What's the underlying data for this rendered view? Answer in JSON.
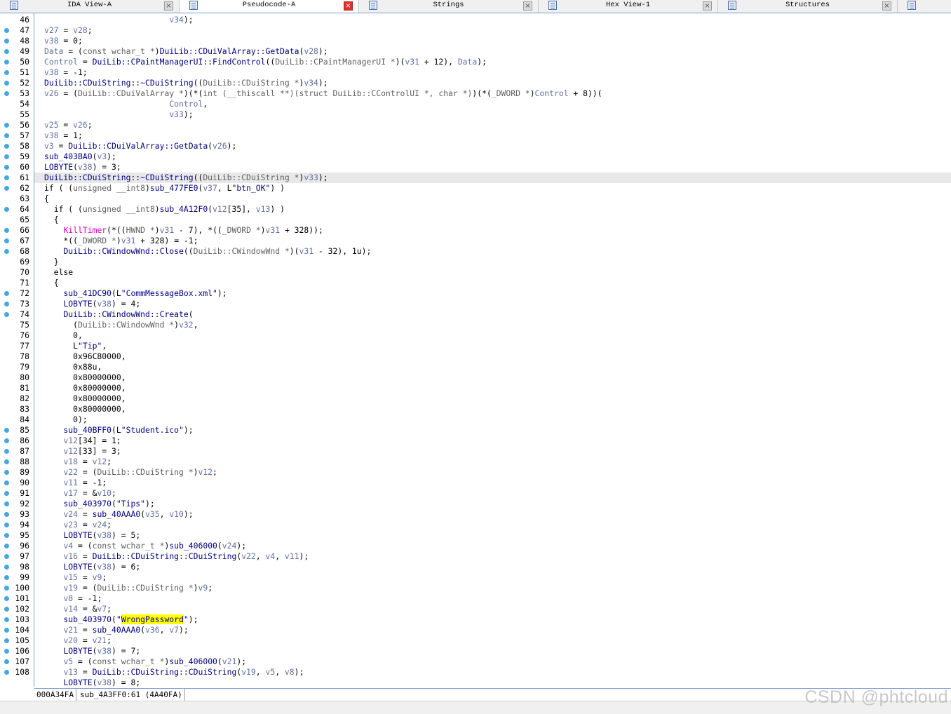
{
  "tabs": [
    {
      "label": "IDA View-A",
      "close": "×",
      "icon": "disassembly-icon",
      "active": false
    },
    {
      "label": "Pseudocode-A",
      "close": "×",
      "icon": "pseudocode-icon",
      "active": true
    },
    {
      "label": "Strings",
      "close": "×",
      "icon": "strings-icon",
      "active": false
    },
    {
      "label": "Hex View-1",
      "close": "×",
      "icon": "hex-view-icon",
      "active": false
    },
    {
      "label": "Structures",
      "close": "×",
      "icon": "structures-icon",
      "active": false
    }
  ],
  "breakpoint_color": "#40a8e8",
  "highlight_line": 61,
  "lines": [
    {
      "n": "46",
      "bp": false,
      "html": "                          <span class=\"v\">v34</span>);"
    },
    {
      "n": "47",
      "bp": true,
      "html": "<span class=\"v\">v27</span> = <span class=\"v\">v28</span>;"
    },
    {
      "n": "48",
      "bp": true,
      "html": "<span class=\"v\">v38</span> = 0;"
    },
    {
      "n": "49",
      "bp": true,
      "html": "<span class=\"v\">Data</span> = (<span class=\"g\">const wchar_t *</span>)<span class=\"k\">DuiLib::CDuiValArray::GetData</span>(<span class=\"v\">v28</span>);"
    },
    {
      "n": "50",
      "bp": true,
      "html": "<span class=\"v\">Control</span> = <span class=\"k\">DuiLib::CPaintManagerUI::FindControl</span>((<span class=\"g\">DuiLib::CPaintManagerUI *</span>)(<span class=\"v\">v31</span> + 12), <span class=\"v\">Data</span>);"
    },
    {
      "n": "51",
      "bp": true,
      "html": "<span class=\"v\">v38</span> = -1;"
    },
    {
      "n": "52",
      "bp": true,
      "html": "<span class=\"k\">DuiLib::CDuiString::~CDuiString</span>((<span class=\"g\">DuiLib::CDuiString *</span>)<span class=\"v\">v34</span>);"
    },
    {
      "n": "53",
      "bp": true,
      "html": "<span class=\"v\">v26</span> = (<span class=\"g\">DuiLib::CDuiValArray *</span>)(*(<span class=\"g\">int (__thiscall **)(struct DuiLib::CControlUI *, char *)</span>)(*(<span class=\"g\">_DWORD *</span>)<span class=\"v\">Control</span> + 8))("
    },
    {
      "n": "54",
      "bp": false,
      "html": "                          <span class=\"v\">Control</span>,"
    },
    {
      "n": "55",
      "bp": false,
      "html": "                          <span class=\"v\">v33</span>);"
    },
    {
      "n": "56",
      "bp": true,
      "html": "<span class=\"v\">v25</span> = <span class=\"v\">v26</span>;"
    },
    {
      "n": "57",
      "bp": true,
      "html": "<span class=\"v\">v38</span> = 1;"
    },
    {
      "n": "58",
      "bp": true,
      "html": "<span class=\"v\">v3</span> = <span class=\"k\">DuiLib::CDuiValArray::GetData</span>(<span class=\"v\">v26</span>);"
    },
    {
      "n": "59",
      "bp": true,
      "html": "<span class=\"k\">sub_403BA0</span>(<span class=\"v\">v3</span>);"
    },
    {
      "n": "60",
      "bp": true,
      "html": "<span class=\"k\">LOBYTE</span>(<span class=\"v\">v38</span>) = 3;"
    },
    {
      "n": "61",
      "bp": true,
      "html": "<span class=\"k\">DuiLib::CDuiString::~CDuiString</span>((<span class=\"g\">DuiLib::CDuiString *</span>)<span class=\"v\">v33</span>);"
    },
    {
      "n": "62",
      "bp": true,
      "html": "if ( (<span class=\"g\">unsigned __int8</span>)<span class=\"k\">sub_477FE0</span>(<span class=\"v\">v37</span>, L<span class=\"s\">\"btn_OK\"</span>) )"
    },
    {
      "n": "63",
      "bp": false,
      "html": "{"
    },
    {
      "n": "64",
      "bp": true,
      "html": "  if ( (<span class=\"g\">unsigned __int8</span>)<span class=\"k\">sub_4A12F0</span>(<span class=\"v\">v12</span>[35], <span class=\"v\">v13</span>) )"
    },
    {
      "n": "65",
      "bp": false,
      "html": "  {"
    },
    {
      "n": "66",
      "bp": true,
      "html": "    <span class=\"m\">KillTimer</span>(*((<span class=\"g\">HWND *</span>)<span class=\"v\">v31</span> - 7), *((<span class=\"g\">_DWORD *</span>)<span class=\"v\">v31</span> + 328));"
    },
    {
      "n": "67",
      "bp": true,
      "html": "    *((<span class=\"g\">_DWORD *</span>)<span class=\"v\">v31</span> + 328) = -1;"
    },
    {
      "n": "68",
      "bp": true,
      "html": "    <span class=\"k\">DuiLib::CWindowWnd::Close</span>((<span class=\"g\">DuiLib::CWindowWnd *</span>)(<span class=\"v\">v31</span> - 32), 1u);"
    },
    {
      "n": "69",
      "bp": false,
      "html": "  }"
    },
    {
      "n": "70",
      "bp": false,
      "html": "  else"
    },
    {
      "n": "71",
      "bp": false,
      "html": "  {"
    },
    {
      "n": "72",
      "bp": true,
      "html": "    <span class=\"k\">sub_41DC90</span>(L<span class=\"s\">\"CommMessageBox.xml\"</span>);"
    },
    {
      "n": "73",
      "bp": true,
      "html": "    <span class=\"k\">LOBYTE</span>(<span class=\"v\">v38</span>) = 4;"
    },
    {
      "n": "74",
      "bp": true,
      "html": "    <span class=\"k\">DuiLib::CWindowWnd::Create</span>("
    },
    {
      "n": "75",
      "bp": false,
      "html": "      (<span class=\"g\">DuiLib::CWindowWnd *</span>)<span class=\"v\">v32</span>,"
    },
    {
      "n": "76",
      "bp": false,
      "html": "      0,"
    },
    {
      "n": "77",
      "bp": false,
      "html": "      L<span class=\"s\">\"Tip\"</span>,"
    },
    {
      "n": "78",
      "bp": false,
      "html": "      0x96C80000,"
    },
    {
      "n": "79",
      "bp": false,
      "html": "      0x88u,"
    },
    {
      "n": "80",
      "bp": false,
      "html": "      0x80000000,"
    },
    {
      "n": "81",
      "bp": false,
      "html": "      0x80000000,"
    },
    {
      "n": "82",
      "bp": false,
      "html": "      0x80000000,"
    },
    {
      "n": "83",
      "bp": false,
      "html": "      0x80000000,"
    },
    {
      "n": "84",
      "bp": false,
      "html": "      0);"
    },
    {
      "n": "85",
      "bp": true,
      "html": "    <span class=\"k\">sub_40BFF0</span>(L<span class=\"s\">\"Student.ico\"</span>);"
    },
    {
      "n": "86",
      "bp": true,
      "html": "    <span class=\"v\">v12</span>[34] = 1;"
    },
    {
      "n": "87",
      "bp": true,
      "html": "    <span class=\"v\">v12</span>[33] = 3;"
    },
    {
      "n": "88",
      "bp": true,
      "html": "    <span class=\"v\">v18</span> = <span class=\"v\">v12</span>;"
    },
    {
      "n": "89",
      "bp": true,
      "html": "    <span class=\"v\">v22</span> = (<span class=\"g\">DuiLib::CDuiString *</span>)<span class=\"v\">v12</span>;"
    },
    {
      "n": "90",
      "bp": true,
      "html": "    <span class=\"v\">v11</span> = -1;"
    },
    {
      "n": "91",
      "bp": true,
      "html": "    <span class=\"v\">v17</span> = &amp;<span class=\"v\">v10</span>;"
    },
    {
      "n": "92",
      "bp": true,
      "html": "    <span class=\"k\">sub_403970</span>(<span class=\"s\">\"Tips\"</span>);"
    },
    {
      "n": "93",
      "bp": true,
      "html": "    <span class=\"v\">v24</span> = <span class=\"k\">sub_40AAA0</span>(<span class=\"v\">v35</span>, <span class=\"v\">v10</span>);"
    },
    {
      "n": "94",
      "bp": true,
      "html": "    <span class=\"v\">v23</span> = <span class=\"v\">v24</span>;"
    },
    {
      "n": "95",
      "bp": true,
      "html": "    <span class=\"k\">LOBYTE</span>(<span class=\"v\">v38</span>) = 5;"
    },
    {
      "n": "96",
      "bp": true,
      "html": "    <span class=\"v\">v4</span> = (<span class=\"g\">const wchar_t *</span>)<span class=\"k\">sub_406000</span>(<span class=\"v\">v24</span>);"
    },
    {
      "n": "97",
      "bp": true,
      "html": "    <span class=\"v\">v16</span> = <span class=\"k\">DuiLib::CDuiString::CDuiString</span>(<span class=\"v\">v22</span>, <span class=\"v\">v4</span>, <span class=\"v\">v11</span>);"
    },
    {
      "n": "98",
      "bp": true,
      "html": "    <span class=\"k\">LOBYTE</span>(<span class=\"v\">v38</span>) = 6;"
    },
    {
      "n": "99",
      "bp": true,
      "html": "    <span class=\"v\">v15</span> = <span class=\"v\">v9</span>;"
    },
    {
      "n": "100",
      "bp": true,
      "html": "    <span class=\"v\">v19</span> = (<span class=\"g\">DuiLib::CDuiString *</span>)<span class=\"v\">v9</span>;"
    },
    {
      "n": "101",
      "bp": true,
      "html": "    <span class=\"v\">v8</span> = -1;"
    },
    {
      "n": "102",
      "bp": true,
      "html": "    <span class=\"v\">v14</span> = &amp;<span class=\"v\">v7</span>;"
    },
    {
      "n": "103",
      "bp": true,
      "html": "    <span class=\"k\">sub_403970</span>(<span class=\"s\">\"<span class=\"y\">WrongPassword</span>\"</span>);"
    },
    {
      "n": "104",
      "bp": true,
      "html": "    <span class=\"v\">v21</span> = <span class=\"k\">sub_40AAA0</span>(<span class=\"v\">v36</span>, <span class=\"v\">v7</span>);"
    },
    {
      "n": "105",
      "bp": true,
      "html": "    <span class=\"v\">v20</span> = <span class=\"v\">v21</span>;"
    },
    {
      "n": "106",
      "bp": true,
      "html": "    <span class=\"k\">LOBYTE</span>(<span class=\"v\">v38</span>) = 7;"
    },
    {
      "n": "107",
      "bp": true,
      "html": "    <span class=\"v\">v5</span> = (<span class=\"g\">const wchar_t *</span>)<span class=\"k\">sub_406000</span>(<span class=\"v\">v21</span>);"
    },
    {
      "n": "108",
      "bp": true,
      "html": "    <span class=\"v\">v13</span> = <span class=\"k\">DuiLib::CDuiString::CDuiString</span>(<span class=\"v\">v19</span>, <span class=\"v\">v5</span>, <span class=\"v\">v8</span>);"
    },
    {
      "n": "",
      "bp": false,
      "html": "    <span class=\"k\">LOBYTE</span>(<span class=\"v\">v38</span>) = 8;"
    }
  ],
  "status": {
    "address": "000A34FA",
    "location": "sub_4A3FF0:61 (4A40FA)"
  },
  "watermark": "CSDN @phtcloud"
}
